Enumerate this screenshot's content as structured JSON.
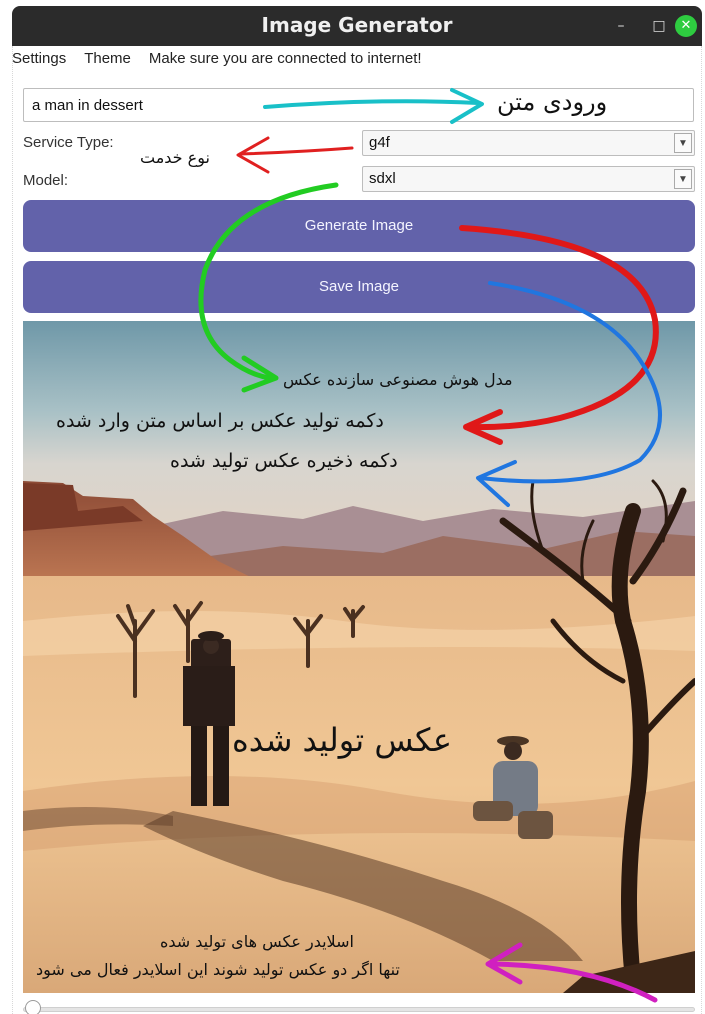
{
  "window": {
    "title": "Image Generator",
    "minimize_glyph": "–",
    "maximize_glyph": "□",
    "close_glyph": "✕"
  },
  "menu": {
    "settings": "Settings",
    "theme": "Theme",
    "notice": "Make sure you are connected to internet!"
  },
  "prompt": {
    "value": "a man in dessert"
  },
  "service": {
    "label": "Service Type:",
    "selected": "g4f"
  },
  "model": {
    "label": "Model:",
    "selected": "sdxl"
  },
  "buttons": {
    "generate": "Generate Image",
    "save": "Save Image"
  },
  "slider": {
    "value": 0
  },
  "annotations": {
    "input": "ورودی متن",
    "service": "نوع خدمت",
    "model": "مدل هوش مصنوعی سازنده عکس",
    "generate": "دکمه تولید عکس بر اساس متن وارد شده",
    "save": "دکمه ذخیره عکس تولید شده",
    "image": "عکس تولید شده",
    "slider_line1": "اسلایدر عکس های تولید شده",
    "slider_line2": "تنها اگر دو عکس تولید شوند این اسلایدر فعال می شود"
  },
  "colors": {
    "button": "#6262aa",
    "arrow_input": "#19c0c8",
    "arrow_service": "#e02020",
    "arrow_model": "#22cc22",
    "arrow_generate": "#e01818",
    "arrow_save": "#2076e0",
    "arrow_slider": "#d020c0"
  }
}
